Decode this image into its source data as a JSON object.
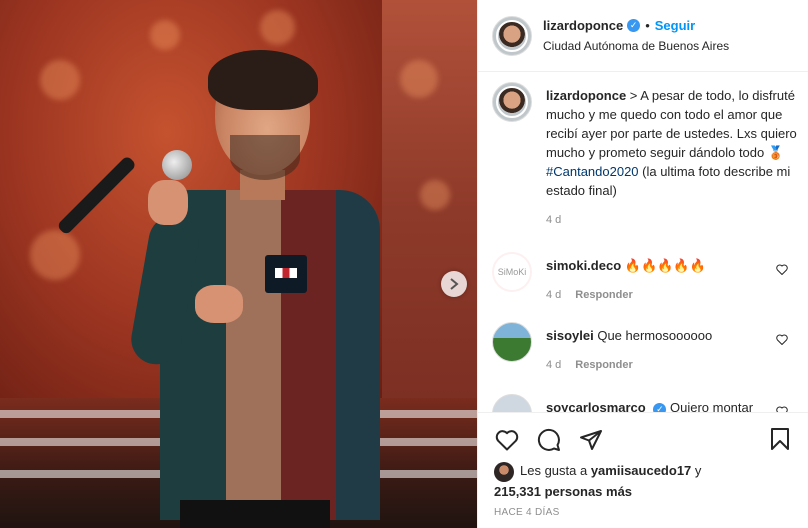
{
  "post": {
    "author": "lizardoponce",
    "follow_label": "Seguir",
    "separator": "•",
    "location": "Ciudad Autónoma de Buenos Aires"
  },
  "caption": {
    "username": "lizardoponce",
    "text_before": " > A pesar de todo, lo disfruté mucho y me quedo con todo el amor que recibí ayer por parte de ustedes. Lxs quiero mucho y prometo seguir dándolo todo 🥉 ",
    "hashtag": "#Cantando2020",
    "text_after": " (la ultima foto describe mi estado final)",
    "age": "4 d"
  },
  "comments": [
    {
      "username": "simoki.deco",
      "text": "🔥🔥🔥🔥🔥",
      "age": "4 d",
      "reply_label": "Responder",
      "avatar_text": "SiMoKi"
    },
    {
      "username": "sisoylei",
      "text": "Que hermosoooooo",
      "age": "4 d",
      "reply_label": "Responder"
    },
    {
      "username": "soycarlosmarco",
      "text": "Quiero montar",
      "verified": true
    }
  ],
  "actions": {
    "liked_by_prefix": "Les gusta a ",
    "liked_by_user": "yamiisaucedo17",
    "liked_by_join": " y",
    "likes_count": "215,331 personas más",
    "timestamp": "HACE 4 DÍAS"
  },
  "icons": [
    "heart-icon",
    "comment-icon",
    "share-icon",
    "bookmark-icon",
    "verified-icon",
    "chevron-right-icon"
  ],
  "colors": {
    "accent": "#0095f6",
    "verified": "#3897f0",
    "hashtag": "#00376b",
    "muted": "#8e8e8e"
  }
}
